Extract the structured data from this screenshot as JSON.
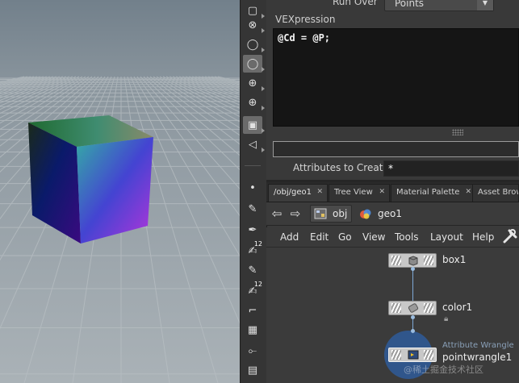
{
  "colors": {
    "accent": "#2f5c9a",
    "viewport_sky": "#8a959d",
    "code_background": "#151515",
    "node_body": "#c8c8c8"
  },
  "viewport": {
    "name": "scene-viewer",
    "object": "box colored by position"
  },
  "shelf": {
    "tools": [
      {
        "name": "select-tool-icon",
        "badge": ""
      },
      {
        "name": "close-circle-icon",
        "badge": ""
      },
      {
        "name": "bulb-tool-icon",
        "badge": ""
      },
      {
        "name": "bulb-selected-icon",
        "badge": ""
      },
      {
        "name": "add-bulb-icon",
        "badge": ""
      },
      {
        "name": "add-light-icon",
        "badge": ""
      },
      {
        "name": "camera-tool-icon",
        "badge": ""
      },
      {
        "name": "handle-tool-icon",
        "badge": ""
      },
      {
        "name": "dot-icon",
        "badge": ""
      },
      {
        "name": "brush-icon",
        "badge": ""
      },
      {
        "name": "pen-icon",
        "badge": ""
      },
      {
        "name": "paint-12-icon",
        "badge": "12"
      },
      {
        "name": "pencil-icon",
        "badge": ""
      },
      {
        "name": "paint-12b-icon",
        "badge": "12"
      },
      {
        "name": "corner-icon",
        "badge": ""
      },
      {
        "name": "transform-box-icon",
        "badge": ""
      },
      {
        "name": "branch-icon",
        "badge": ""
      },
      {
        "name": "grid-icon",
        "badge": ""
      }
    ]
  },
  "params": {
    "run_over_label": "Run Over",
    "run_over_value": "Points",
    "vex_label": "VEXpression",
    "vex_code": "@Cd = @P;",
    "expression_value": "",
    "attributes_label": "Attributes to Create",
    "attributes_value": "*"
  },
  "tabs": [
    {
      "label": "/obj/geo1",
      "active": true
    },
    {
      "label": "Tree View",
      "active": false
    },
    {
      "label": "Material Palette",
      "active": false
    },
    {
      "label": "Asset Brows",
      "active": false
    }
  ],
  "path": {
    "crumb1": "obj",
    "crumb2": "geo1"
  },
  "menu": [
    "Add",
    "Edit",
    "Go",
    "View",
    "Tools",
    "Layout",
    "Help"
  ],
  "nodes": [
    {
      "id": "box1",
      "label": "box1"
    },
    {
      "id": "color1",
      "label": "color1"
    },
    {
      "id": "pointwrangle1",
      "label": "pointwrangle1",
      "type": "Attribute Wrangle"
    }
  ],
  "watermark": "@稀土掘金技术社区"
}
